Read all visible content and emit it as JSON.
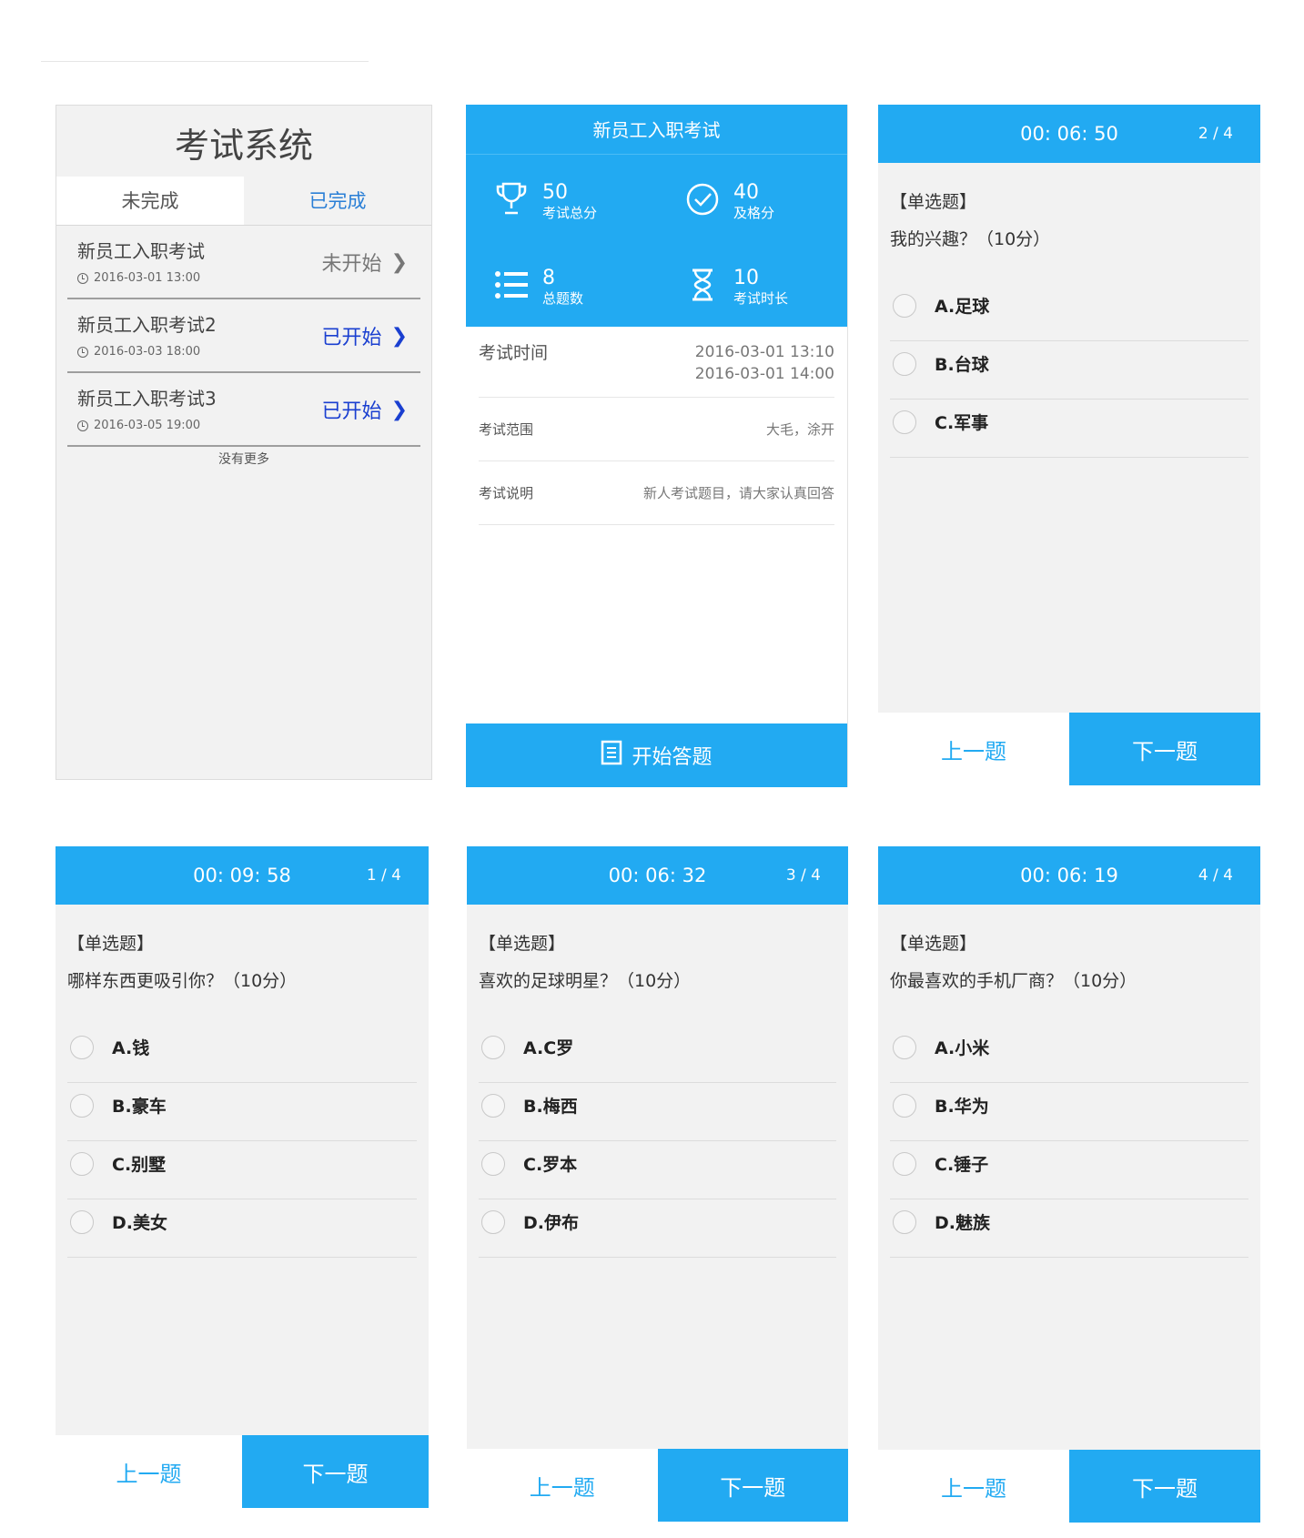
{
  "exam_list": {
    "title": "考试系统",
    "tabs": [
      "未完成",
      "已完成"
    ],
    "exams": [
      {
        "name": "新员工入职考试",
        "date": "2016-03-01 13:00",
        "status": "未开始"
      },
      {
        "name": "新员工入职考试2",
        "date": "2016-03-03 18:00",
        "status": "已开始"
      },
      {
        "name": "新员工入职考试3",
        "date": "2016-03-05 19:00",
        "status": "已开始"
      }
    ],
    "no_more": "没有更多"
  },
  "exam_detail": {
    "title": "新员工入职考试",
    "stats": [
      {
        "value": "50",
        "label": "考试总分",
        "icon": "trophy-icon"
      },
      {
        "value": "40",
        "label": "及格分",
        "icon": "check-circle-icon"
      },
      {
        "value": "8",
        "label": "总题数",
        "icon": "list-icon"
      },
      {
        "value": "10",
        "label": "考试时长",
        "icon": "hourglass-icon"
      }
    ],
    "time_label": "考试时间",
    "time_start": "2016-03-01 13:10",
    "time_end": "2016-03-01 14:00",
    "scope_label": "考试范围",
    "scope_value": "大毛，涂开",
    "note_label": "考试说明",
    "note_value": "新人考试题目，请大家认真回答",
    "start_button": "开始答题"
  },
  "nav": {
    "prev": "上一题",
    "next": "下一题"
  },
  "questions": [
    {
      "timer": "00: 06: 50",
      "count": "2 / 4",
      "type": "【单选题】",
      "text": "我的兴趣？（10分）",
      "options": [
        "A.足球",
        "B.台球",
        "C.军事"
      ]
    },
    {
      "timer": "00: 09: 58",
      "count": "1 / 4",
      "type": "【单选题】",
      "text": "哪样东西更吸引你？（10分）",
      "options": [
        "A.钱",
        "B.豪车",
        "C.别墅",
        "D.美女"
      ]
    },
    {
      "timer": "00: 06: 32",
      "count": "3 / 4",
      "type": "【单选题】",
      "text": "喜欢的足球明星？（10分）",
      "options": [
        "A.C罗",
        "B.梅西",
        "C.罗本",
        "D.伊布"
      ]
    },
    {
      "timer": "00: 06: 19",
      "count": "4 / 4",
      "type": "【单选题】",
      "text": "你最喜欢的手机厂商？（10分）",
      "options": [
        "A.小米",
        "B.华为",
        "C.锤子",
        "D.魅族"
      ]
    }
  ],
  "colors": {
    "accent": "#22aaf2",
    "panel_bg": "#f2f2f2",
    "link_blue": "#1a3fd0"
  }
}
